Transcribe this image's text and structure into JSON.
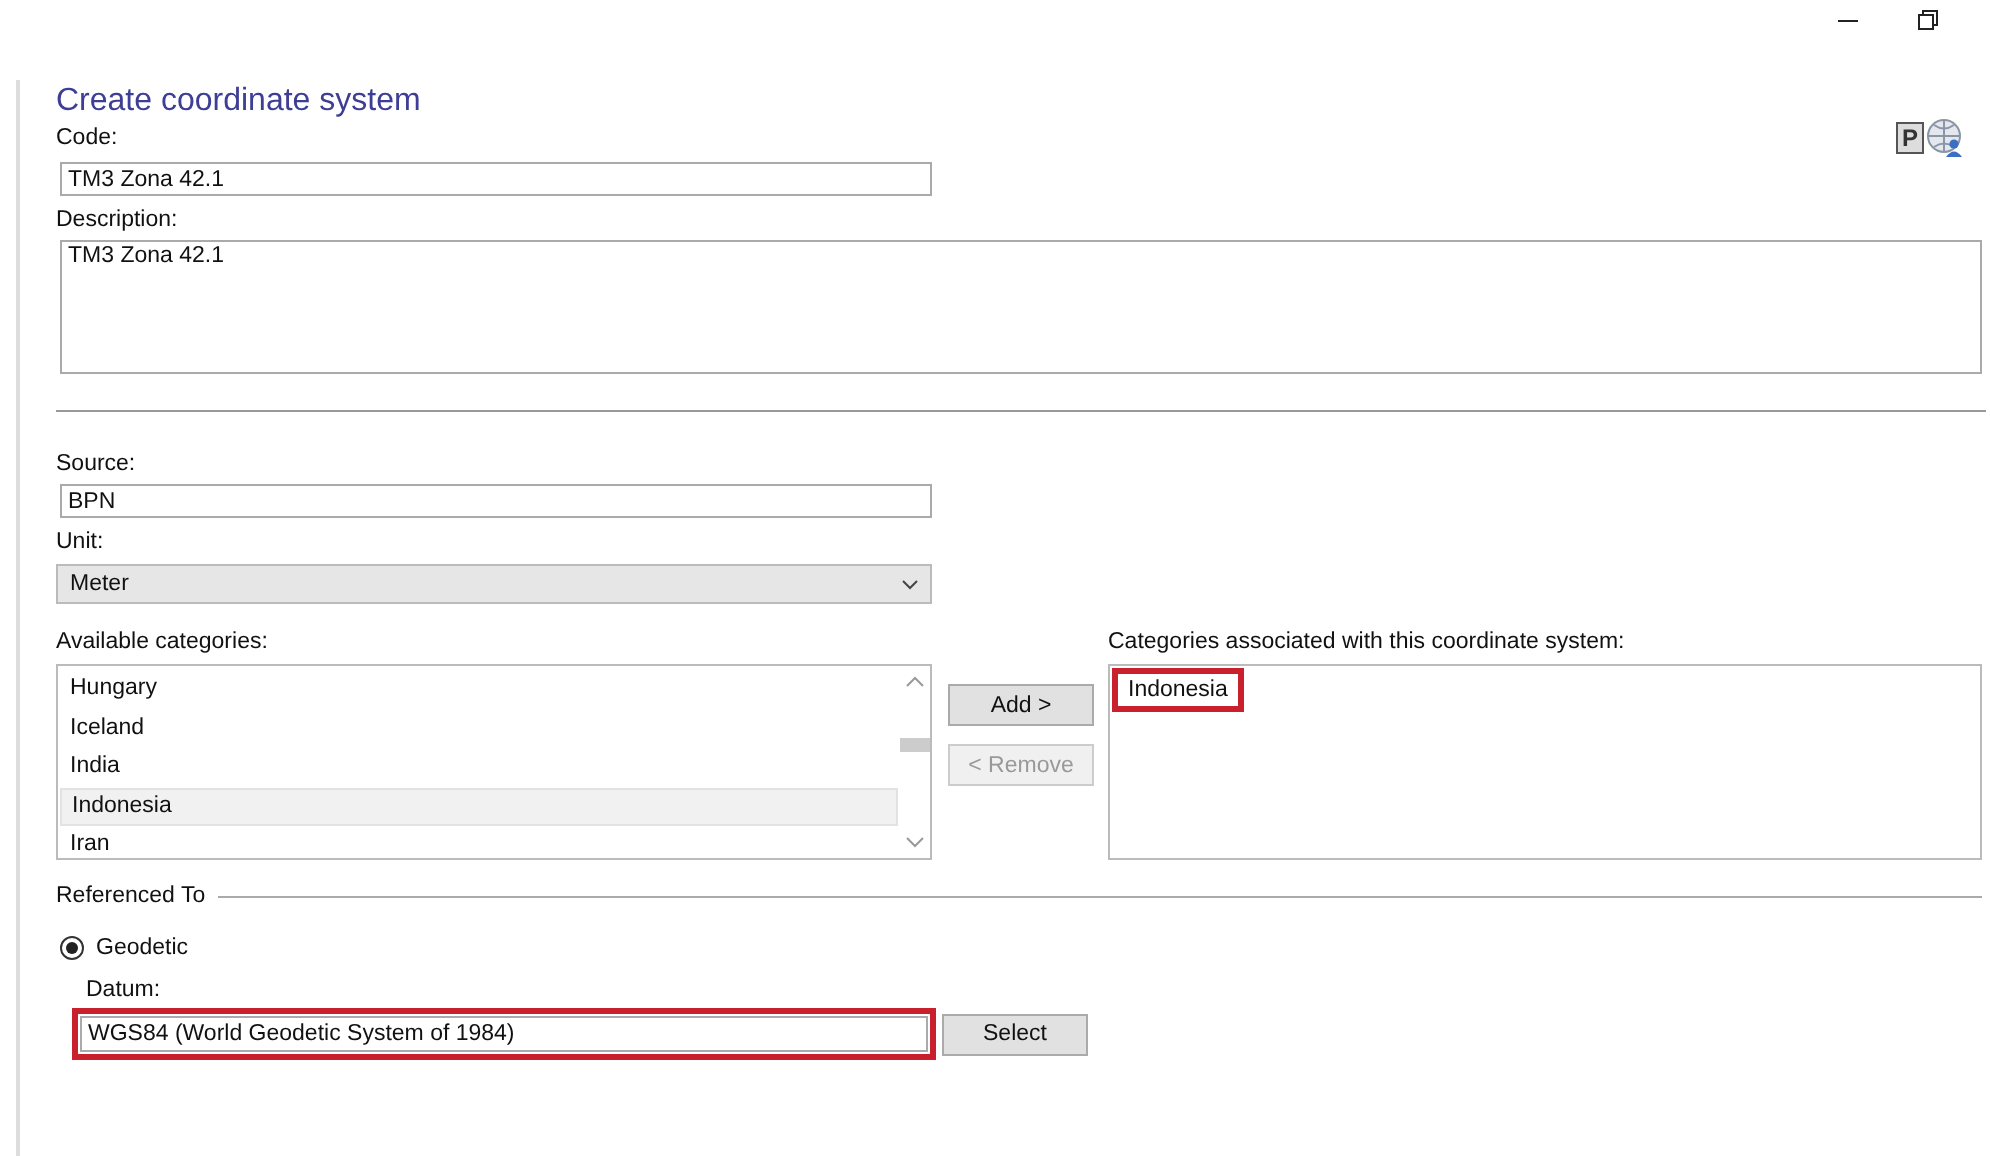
{
  "window_controls": [
    {
      "kind": "minimize"
    },
    {
      "kind": "restore"
    }
  ],
  "title": "Create coordinate system",
  "badge_icon_letter": "P",
  "code": {
    "label": "Code:",
    "value": "TM3 Zona 42.1"
  },
  "description": {
    "label": "Description:",
    "value": "TM3 Zona 42.1"
  },
  "source": {
    "label": "Source:",
    "value": "BPN"
  },
  "unit": {
    "label": "Unit:",
    "value": "Meter"
  },
  "available_categories": {
    "label": "Available categories:",
    "items": [
      {
        "text": "Hungary",
        "selected": false
      },
      {
        "text": "Iceland",
        "selected": false
      },
      {
        "text": "India",
        "selected": false
      },
      {
        "text": "Indonesia",
        "selected": true
      },
      {
        "text": "Iran",
        "selected": false
      }
    ]
  },
  "buttons": [
    {
      "label": "Add >",
      "disabled": false
    },
    {
      "label": "< Remove",
      "disabled": true
    }
  ],
  "associated_categories": {
    "label": "Categories associated with this coordinate system:",
    "items": [
      {
        "text": "Indonesia",
        "highlighted": true
      }
    ]
  },
  "referenced_to": {
    "label": "Referenced To",
    "options": [
      {
        "label": "Geodetic",
        "selected": true
      }
    ]
  },
  "datum": {
    "label": "Datum:",
    "value": "WGS84 (World Geodetic System of 1984)",
    "highlighted": true,
    "button": "Select"
  }
}
